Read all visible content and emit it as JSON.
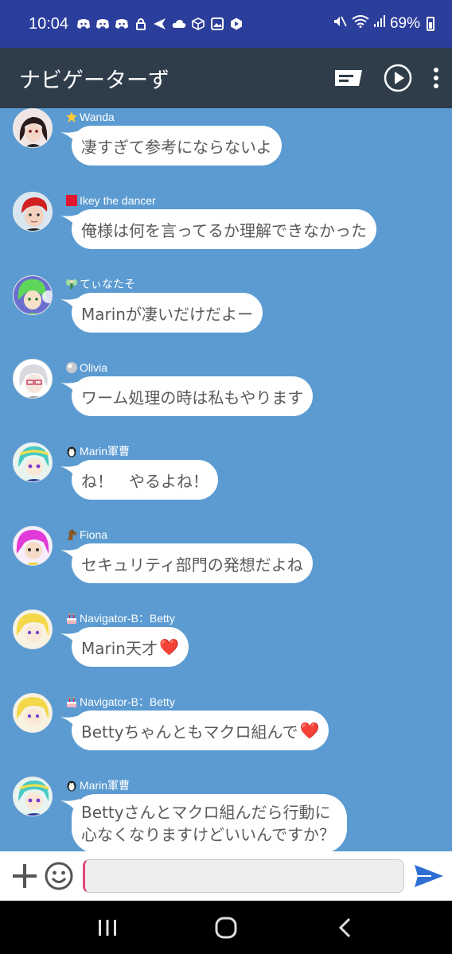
{
  "status_bar": {
    "time": "10:04",
    "battery": "69%"
  },
  "app_bar": {
    "title": "ナビゲーターず"
  },
  "messages": [
    {
      "name": "Wanda",
      "badge": "star",
      "text": "凄すぎて参考にならないよ"
    },
    {
      "name": "Ikey the dancer",
      "badge": "red-square",
      "text": "俺様は何を言ってるか理解できなかった"
    },
    {
      "name": "てぃなたそ",
      "badge": "fairy",
      "text": "Marinが凄いだけだよー"
    },
    {
      "name": "Olivia",
      "badge": "orb",
      "text": "ワーム処理の時は私もやります"
    },
    {
      "name": "Marin軍曹",
      "badge": "penguin",
      "text": "ね！　やるよね！"
    },
    {
      "name": "Fiona",
      "badge": "horse",
      "text": "セキュリティ部門の発想だよね"
    },
    {
      "name": "Navigator-B：Betty",
      "badge": "cake",
      "text": "Marin天才",
      "heart": "❤️"
    },
    {
      "name": "Navigator-B：Betty",
      "badge": "cake",
      "text": "Bettyちゃんともマクロ組んで",
      "heart": "❤️"
    },
    {
      "name": "Marin軍曹",
      "badge": "penguin",
      "text": "Bettyさんとマクロ組んだら行動に心なくなりますけどいいんですか？"
    }
  ],
  "input": {
    "value": "",
    "placeholder": ""
  },
  "colors": {
    "chat_bg": "#5b9bd1",
    "app_bar": "#2f3d4a",
    "status_bar": "#2c3e9b",
    "send": "#2f6fd4"
  }
}
